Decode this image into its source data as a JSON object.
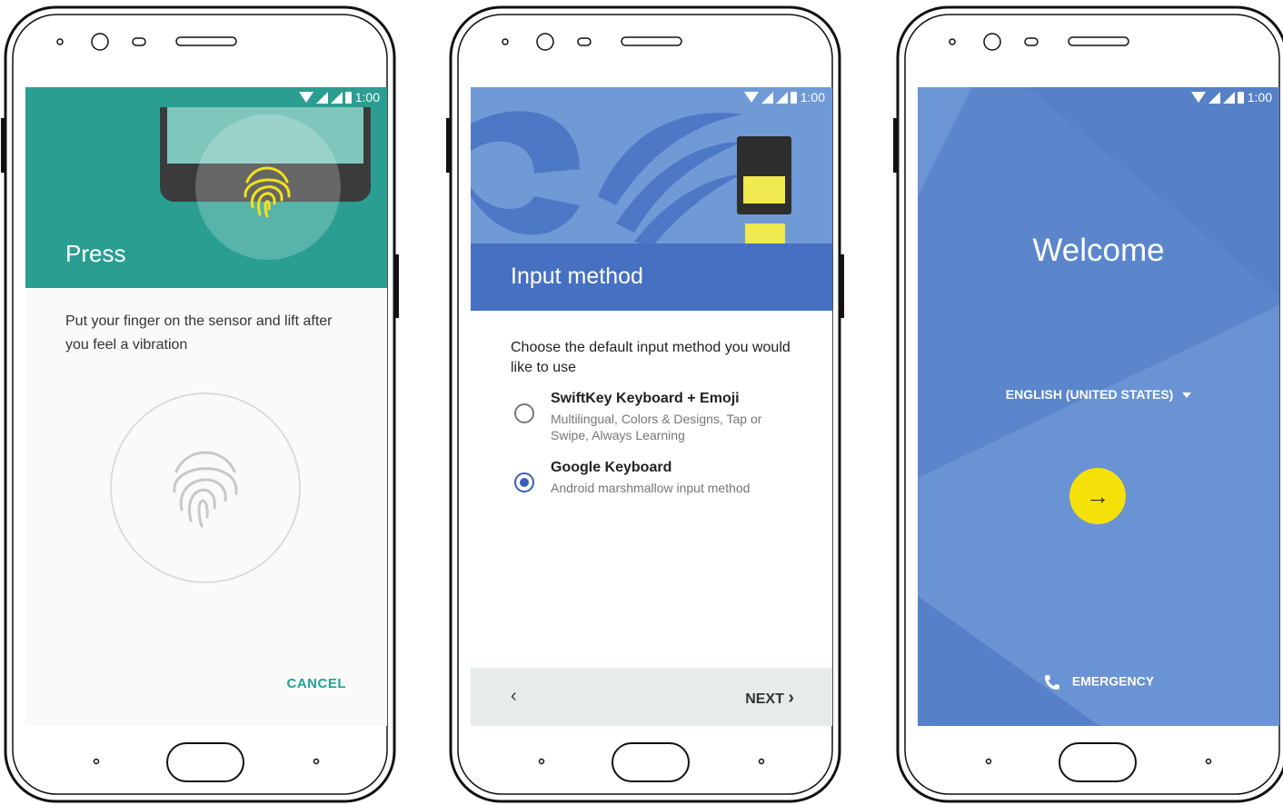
{
  "status": {
    "time": "1:00"
  },
  "fingerprint_screen": {
    "title": "Press",
    "description": "Put your finger on the sensor and lift after you feel a vibration",
    "cancel_label": "CANCEL",
    "accent_color": "#2a9e90",
    "icon": "fingerprint-icon"
  },
  "input_method_screen": {
    "title": "Input method",
    "prompt": "Choose the default input method you would like to use",
    "options": [
      {
        "name": "SwiftKey Keyboard + Emoji",
        "description": "Multilingual, Colors & Designs, Tap or Swipe, Always Learning",
        "selected": false
      },
      {
        "name": "Google Keyboard",
        "description": "Android marshmallow input method",
        "selected": true
      }
    ],
    "back_icon": "chevron-left-icon",
    "next_label": "NEXT",
    "accent_color": "#4671c2"
  },
  "welcome_screen": {
    "title": "Welcome",
    "language": "ENGLISH (UNITED STATES)",
    "next_icon": "arrow-right-icon",
    "emergency_label": "EMERGENCY",
    "background_color": "#5681c8",
    "button_color": "#f5e10a"
  }
}
